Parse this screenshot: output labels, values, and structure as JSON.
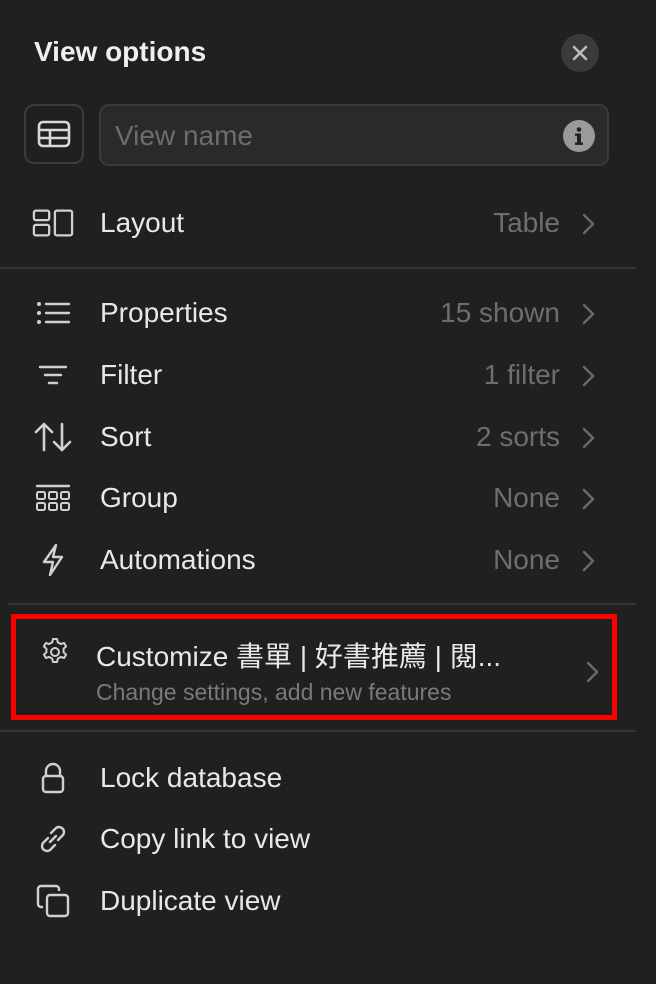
{
  "header": {
    "title": "View options"
  },
  "view_name": {
    "placeholder": "View name",
    "value": ""
  },
  "layout": {
    "label": "Layout",
    "value": "Table"
  },
  "menu": [
    {
      "key": "properties",
      "label": "Properties",
      "value": "15 shown"
    },
    {
      "key": "filter",
      "label": "Filter",
      "value": "1 filter"
    },
    {
      "key": "sort",
      "label": "Sort",
      "value": "2 sorts"
    },
    {
      "key": "group",
      "label": "Group",
      "value": "None"
    },
    {
      "key": "automations",
      "label": "Automations",
      "value": "None"
    }
  ],
  "customize": {
    "title": "Customize 書單 | 好書推薦 | 閱...",
    "subtitle": "Change settings, add new features"
  },
  "actions": [
    {
      "key": "lock",
      "label": "Lock database"
    },
    {
      "key": "copy_link",
      "label": "Copy link to view"
    },
    {
      "key": "duplicate",
      "label": "Duplicate view"
    }
  ],
  "colors": {
    "background": "#202020",
    "highlight": "#ff0000",
    "muted": "#6e6e6e",
    "text": "#e8e8e8"
  }
}
